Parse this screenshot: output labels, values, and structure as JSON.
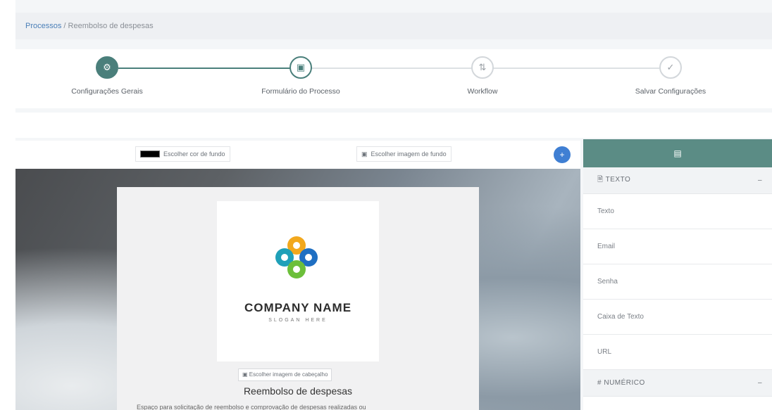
{
  "breadcrumb": {
    "root": "Processos",
    "separator": "/",
    "current": "Reembolso de despesas"
  },
  "steps": [
    {
      "label": "Configurações Gerais",
      "icon": "⚙",
      "state": "done"
    },
    {
      "label": "Formulário do Processo",
      "icon": "▣",
      "state": "active"
    },
    {
      "label": "Workflow",
      "icon": "⇅",
      "state": "pending"
    },
    {
      "label": "Salvar Configurações",
      "icon": "✓",
      "state": "pending"
    }
  ],
  "toolbar": {
    "bg_color_label": "Escolher cor de fundo",
    "bg_image_label": "Escolher imagem de fundo",
    "bg_image_icon": "▣",
    "add_icon": "+"
  },
  "form": {
    "company_name": "COMPANY NAME",
    "slogan": "SLOGAN HERE",
    "header_image_icon": "▣",
    "header_image_label": "Escolher imagem de cabeçalho",
    "title": "Reembolso de despesas",
    "description": "Espaço para solicitação de reembolso e comprovação de despesas realizadas ou"
  },
  "panel": {
    "head_icon": "▤",
    "sections": [
      {
        "icon": "🗎",
        "label": "TEXTO",
        "toggle": "–",
        "items": [
          "Texto",
          "Email",
          "Senha",
          "Caixa de Texto",
          "URL"
        ]
      },
      {
        "icon": "#",
        "label": "NUMÉRICO",
        "toggle": "–",
        "items": []
      }
    ]
  },
  "colors": {
    "primary": "#4a7f7b",
    "panel_header": "#5b8c85",
    "add_button": "#3f7fd3"
  }
}
